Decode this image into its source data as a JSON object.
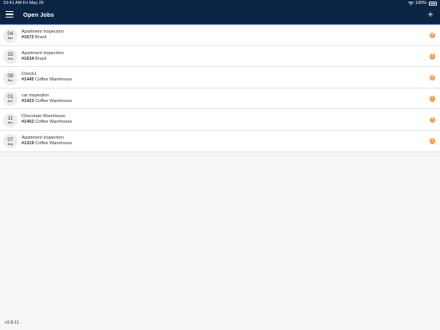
{
  "status_bar": {
    "time_date": "10:41 AM  Fri May 26",
    "battery": "100%"
  },
  "header": {
    "title": "Open Jobs"
  },
  "jobs": [
    {
      "day": "04",
      "month": "Mar",
      "name": "Apartment Inspection",
      "number": "#1672",
      "location": "Brazil"
    },
    {
      "day": "15",
      "month": "Feb",
      "name": "Apartment Inspection",
      "number": "#1634",
      "location": "Brazil"
    },
    {
      "day": "09",
      "month": "Dec",
      "name": "Check1",
      "number": "#1445",
      "location": "Coffee Warehouse"
    },
    {
      "day": "01",
      "month": "Dec",
      "name": "car inspection",
      "number": "#1423",
      "location": "Coffee Warehouse"
    },
    {
      "day": "11",
      "month": "Nov",
      "name": "Chocolate Warehouse",
      "number": "#1402",
      "location": "Coffee Warehouse"
    },
    {
      "day": "07",
      "month": "Sep",
      "name": "Apartment Inspection",
      "number": "#1319",
      "location": "Coffee Warehouse"
    }
  ],
  "alert_glyph": "!",
  "add_glyph": "+",
  "footer": {
    "version": "v3.8.11"
  },
  "colors": {
    "header_bg": "#0b2545",
    "accent": "#2e5bd6",
    "alert": "#f5a15a"
  }
}
